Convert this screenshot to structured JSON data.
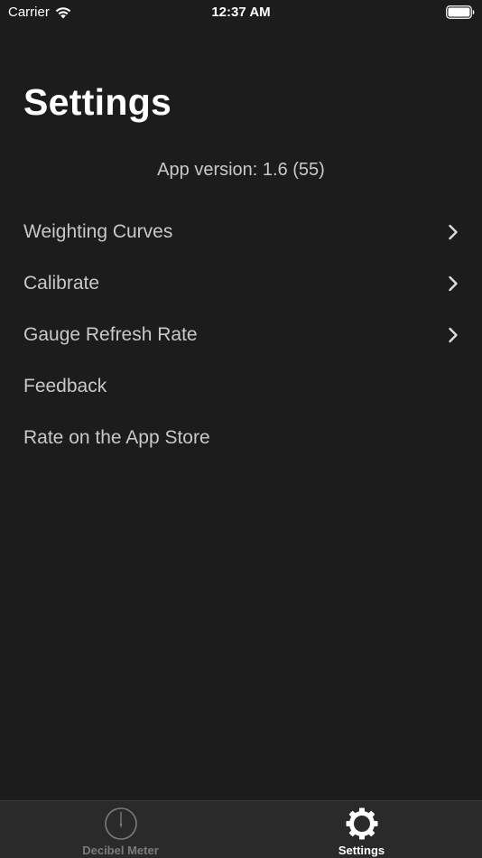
{
  "status_bar": {
    "carrier": "Carrier",
    "time": "12:37 AM"
  },
  "header": {
    "title": "Settings"
  },
  "version_text": "App version: 1.6 (55)",
  "menu": {
    "items": [
      {
        "label": "Weighting Curves",
        "chevron": true
      },
      {
        "label": "Calibrate",
        "chevron": true
      },
      {
        "label": "Gauge Refresh Rate",
        "chevron": true
      },
      {
        "label": "Feedback",
        "chevron": false
      },
      {
        "label": "Rate on the App Store",
        "chevron": false
      }
    ]
  },
  "tab_bar": {
    "tabs": [
      {
        "label": "Decibel Meter",
        "icon": "gauge-icon",
        "active": false
      },
      {
        "label": "Settings",
        "icon": "gear-icon",
        "active": true
      }
    ]
  },
  "colors": {
    "background": "#1c1c1c",
    "tab_bar": "#2a2a2a",
    "text_secondary": "#c8c8c8",
    "tab_inactive": "#7b7b7b",
    "tab_active": "#ffffff"
  }
}
